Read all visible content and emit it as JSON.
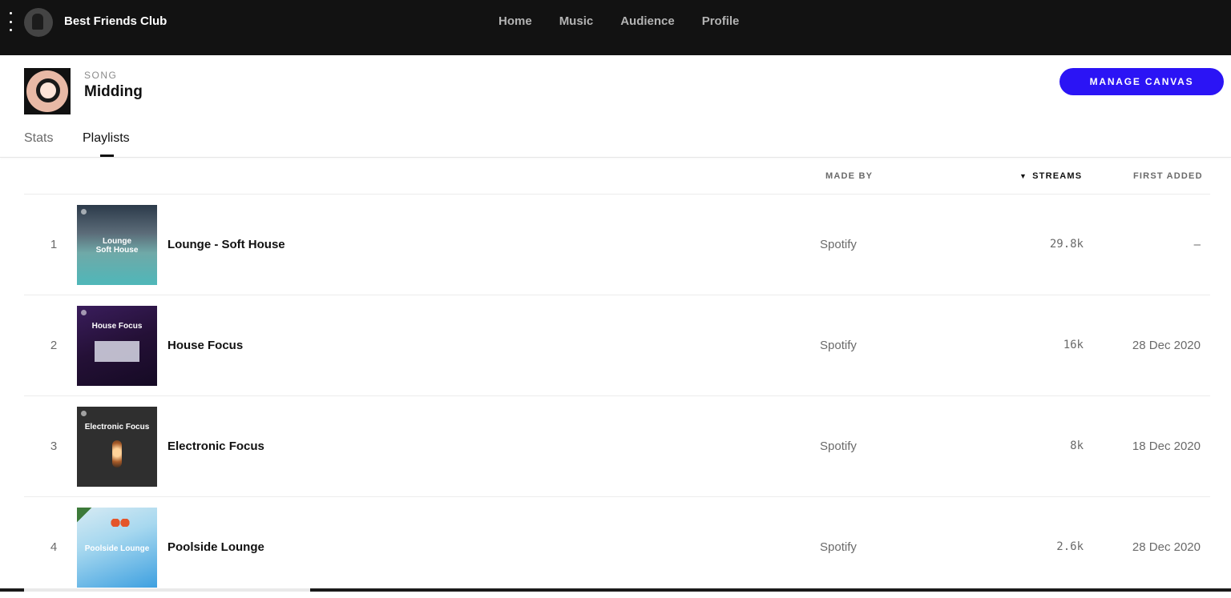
{
  "topbar": {
    "artist_name": "Best Friends Club",
    "nav": [
      "Home",
      "Music",
      "Audience",
      "Profile"
    ]
  },
  "song": {
    "label": "SONG",
    "title": "Midding",
    "manage_button": "MANAGE CANVAS"
  },
  "tabs": [
    {
      "label": "Stats",
      "active": false
    },
    {
      "label": "Playlists",
      "active": true
    }
  ],
  "table": {
    "headers": {
      "made_by": "MADE BY",
      "streams": "STREAMS",
      "streams_sort_icon": "sort-down-icon",
      "first_added": "FIRST ADDED"
    },
    "rows": [
      {
        "index": "1",
        "name": "Lounge - Soft House",
        "cover_caption": "Lounge\nSoft House",
        "made_by": "Spotify",
        "streams": "29.8k",
        "first_added": "–"
      },
      {
        "index": "2",
        "name": "House Focus",
        "cover_caption": "House Focus",
        "made_by": "Spotify",
        "streams": "16k",
        "first_added": "28 Dec 2020"
      },
      {
        "index": "3",
        "name": "Electronic Focus",
        "cover_caption": "Electronic Focus",
        "made_by": "Spotify",
        "streams": "8k",
        "first_added": "18 Dec 2020"
      },
      {
        "index": "4",
        "name": "Poolside Lounge",
        "cover_caption": "Poolside Lounge",
        "made_by": "Spotify",
        "streams": "2.6k",
        "first_added": "28 Dec 2020"
      }
    ]
  },
  "colors": {
    "topbar_bg": "#121212",
    "accent_button": "#2b14f5"
  }
}
